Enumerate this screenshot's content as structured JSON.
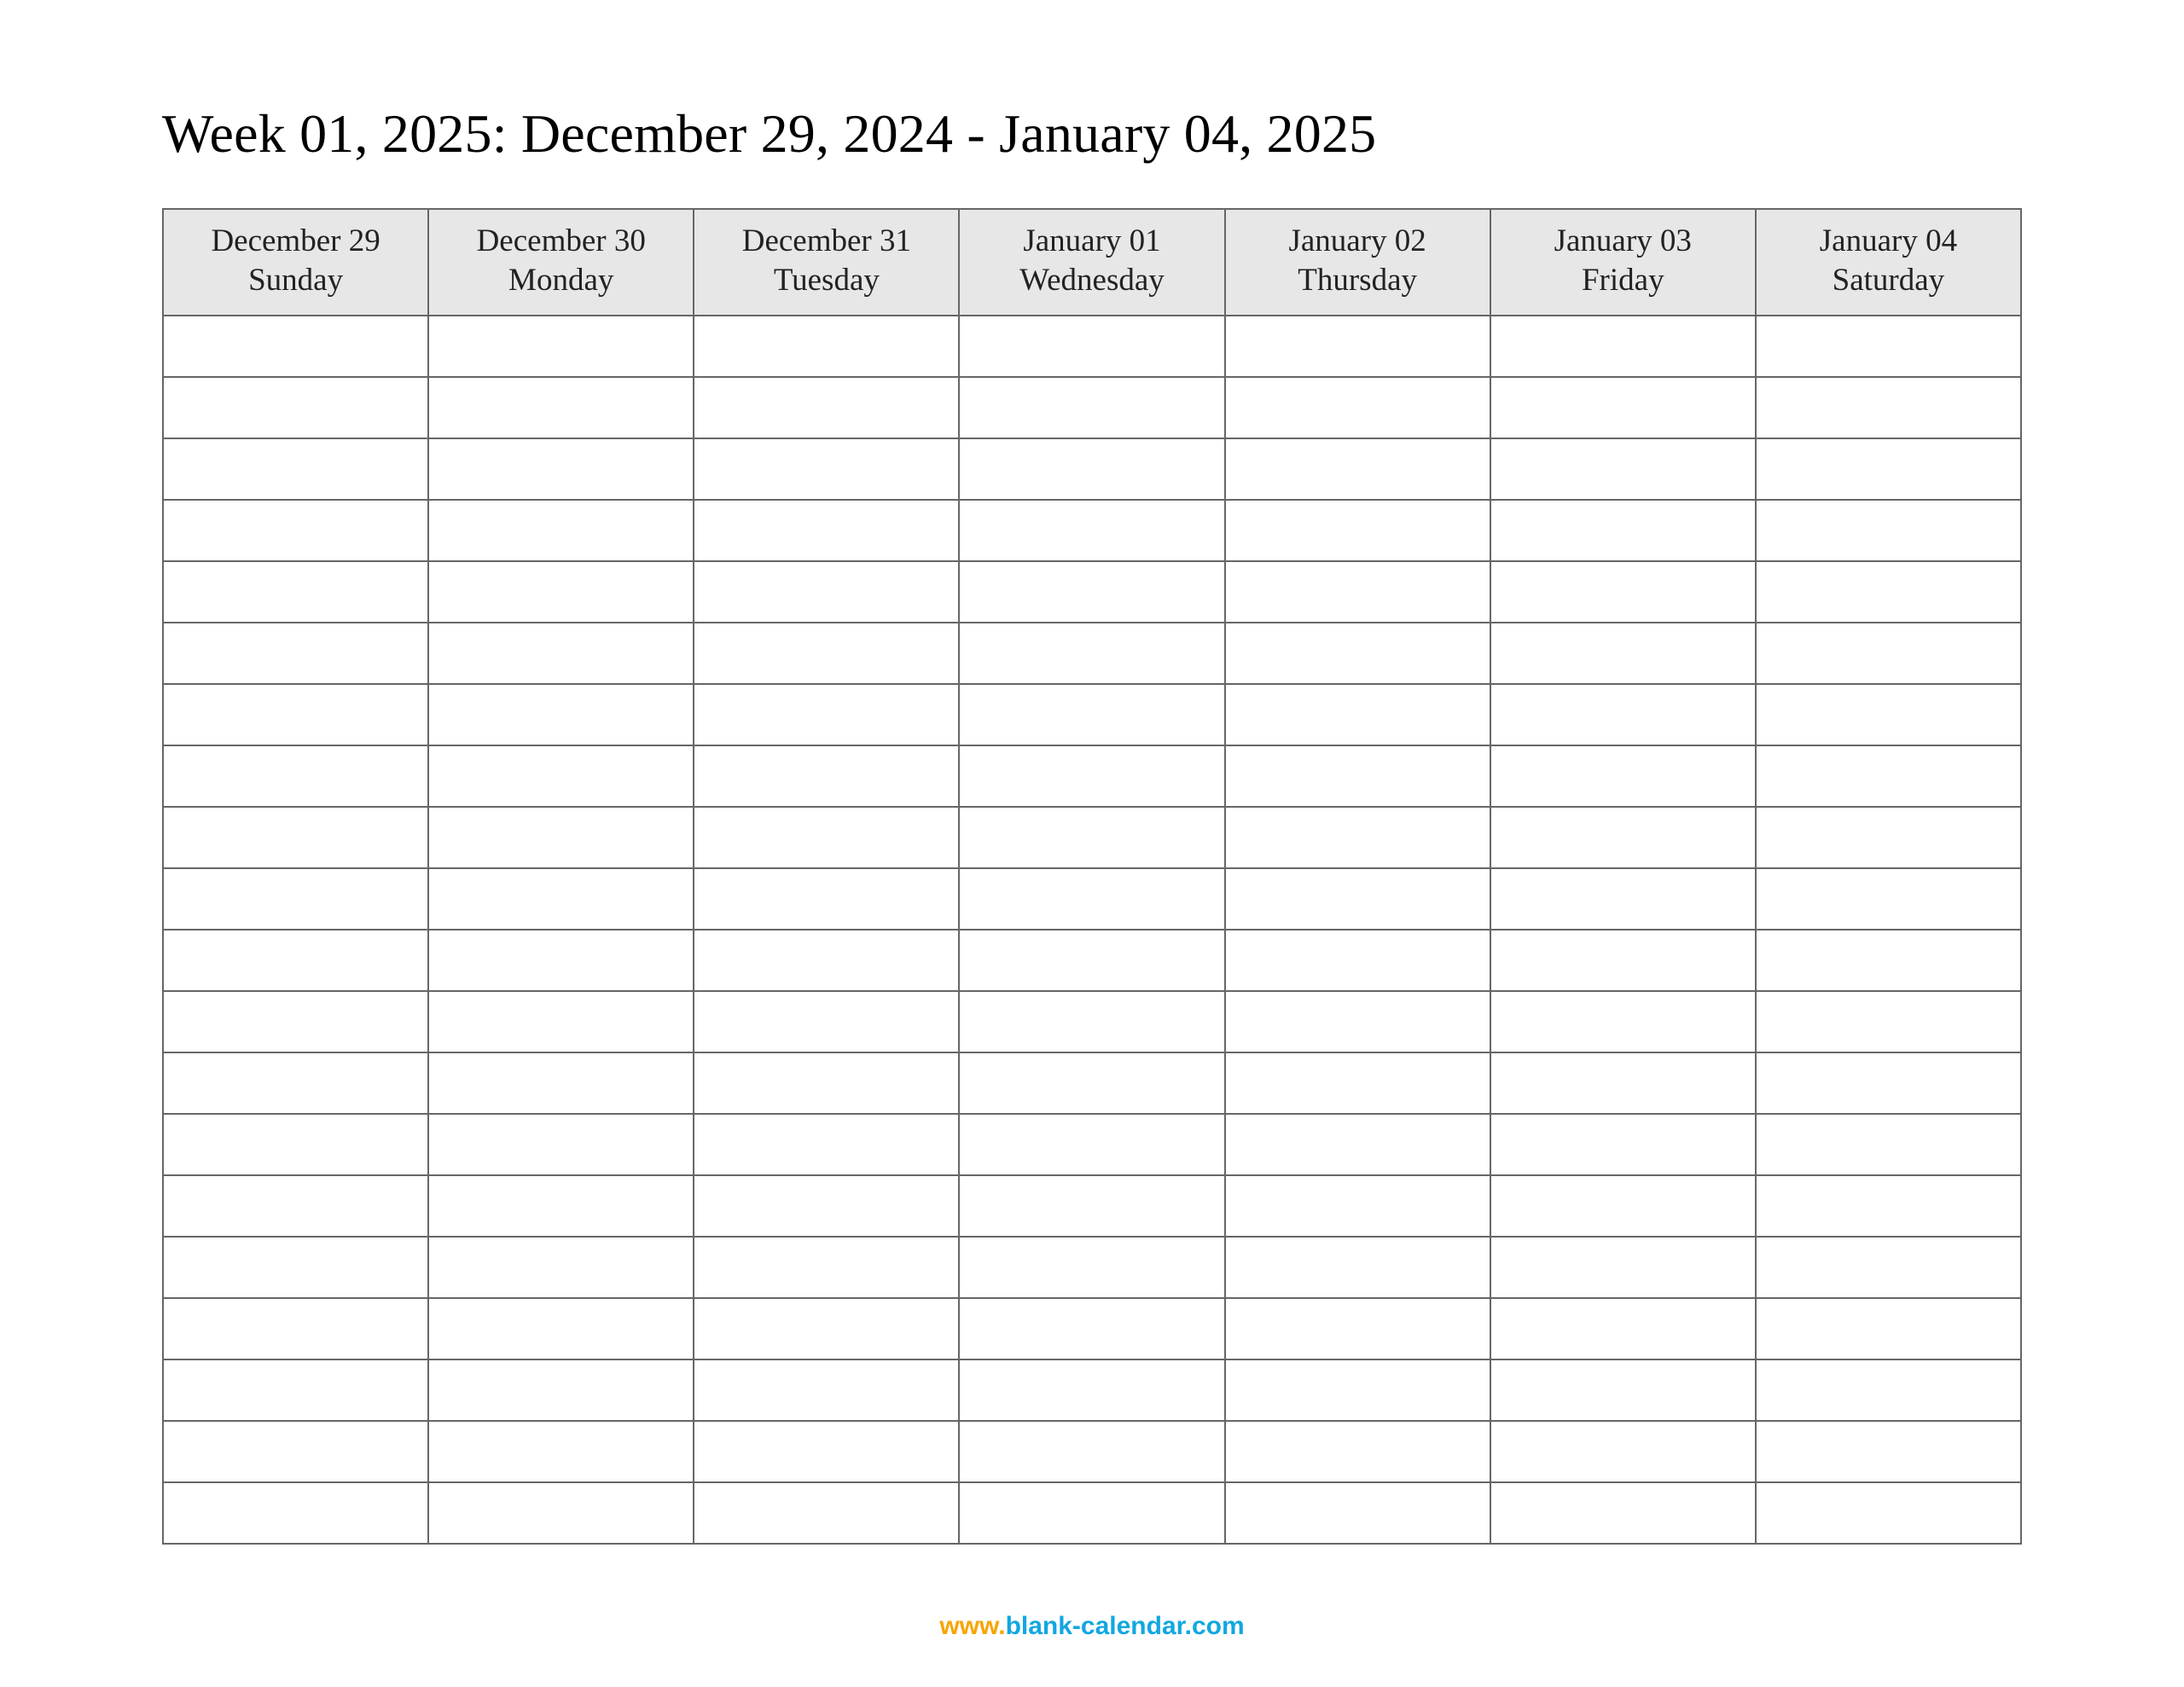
{
  "title": "Week 01, 2025: December 29, 2024 - January 04, 2025",
  "columns": [
    {
      "date": "December 29",
      "weekday": "Sunday"
    },
    {
      "date": "December 30",
      "weekday": "Monday"
    },
    {
      "date": "December 31",
      "weekday": "Tuesday"
    },
    {
      "date": "January 01",
      "weekday": "Wednesday"
    },
    {
      "date": "January 02",
      "weekday": "Thursday"
    },
    {
      "date": "January 03",
      "weekday": "Friday"
    },
    {
      "date": "January 04",
      "weekday": "Saturday"
    }
  ],
  "row_count": 20,
  "footer": {
    "www": "www.",
    "domain": "blank-calendar.com"
  }
}
